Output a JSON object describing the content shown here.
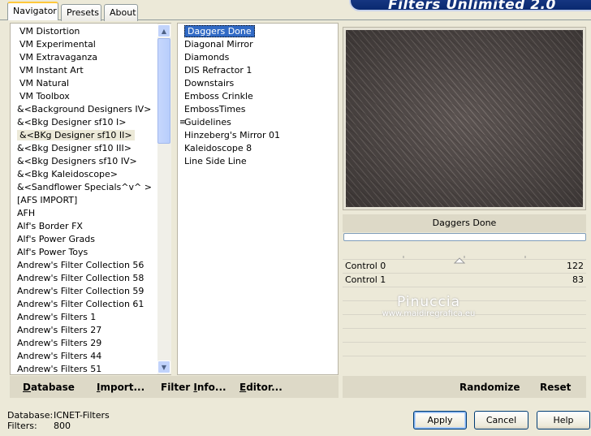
{
  "app": {
    "title": "Filters Unlimited 2.0"
  },
  "tabs": [
    "Navigator",
    "Presets",
    "About"
  ],
  "categories": [
    "VM Distortion",
    "VM Experimental",
    "VM Extravaganza",
    "VM Instant Art",
    "VM Natural",
    "VM Toolbox",
    "&<Background Designers IV>",
    "&<Bkg Designer sf10 I>",
    "&<BKg Designer sf10 II>",
    "&<Bkg Designer sf10 III>",
    "&<Bkg Designers sf10 IV>",
    "&<Bkg Kaleidoscope>",
    "&<Sandflower Specials^v^ >",
    "[AFS IMPORT]",
    "AFH",
    "Alf's Border FX",
    "Alf's Power Grads",
    "Alf's Power Toys",
    "Andrew's Filter Collection 56",
    "Andrew's Filter Collection 58",
    "Andrew's Filter Collection 59",
    "Andrew's Filter Collection 61",
    "Andrew's Filters 1",
    "Andrew's Filters 27",
    "Andrew's Filters 29",
    "Andrew's Filters 44",
    "Andrew's Filters 51"
  ],
  "filters": [
    "Daggers Done",
    "Diagonal Mirror",
    "Diamonds",
    "DIS Refractor 1",
    "Downstairs",
    "Emboss Crinkle",
    "EmbossTimes",
    "Guidelines",
    "Hinzeberg's Mirror 01",
    "Kaleidoscope 8",
    "Line Side Line"
  ],
  "selected_filter": "Daggers Done",
  "controls": [
    {
      "label": "Control 0",
      "value": "122"
    },
    {
      "label": "Control  1",
      "value": "83"
    }
  ],
  "left_buttons": {
    "database": "Database",
    "import": "Import...",
    "filter_info": "Filter Info...",
    "editor": "Editor..."
  },
  "right_buttons": {
    "randomize": "Randomize",
    "reset": "Reset"
  },
  "status": {
    "database_label": "Database:",
    "database_value": "ICNET-Filters",
    "filters_label": "Filters:",
    "filters_value": "800"
  },
  "dialog_buttons": {
    "apply": "Apply",
    "cancel": "Cancel",
    "help": "Help"
  },
  "watermark": {
    "name": "Pinuccia",
    "url": "www.maidiregrafica.eu"
  },
  "colors": {
    "selection": "#316ac5",
    "banner": "#0a2a70",
    "preview": "#5b5351"
  }
}
